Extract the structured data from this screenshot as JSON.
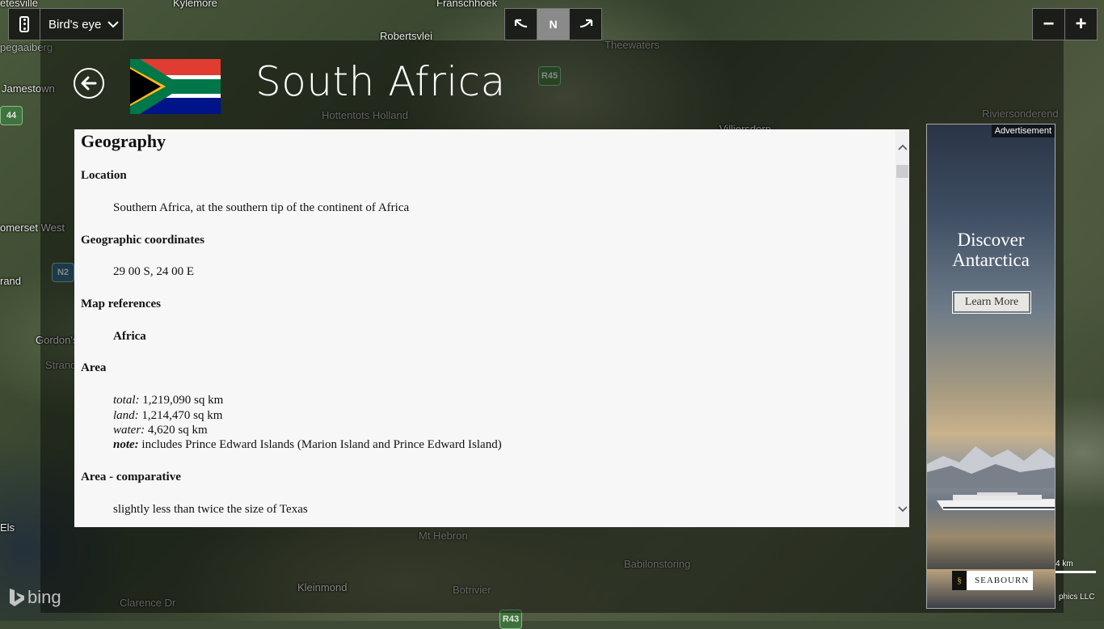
{
  "map": {
    "labels": [
      "etesville",
      "Kylemore",
      "Franschhoek",
      "Robertsvlei",
      "pegaaiberg",
      "Jamestown",
      "Theewaters",
      "Villiersdorp",
      "Hottentots Holland",
      "Riviersonderend",
      "omerset West",
      "rand",
      "Gordon's",
      "Strand",
      "Els",
      "Mt Hebron",
      "Babilonstoring",
      "Kleinmond",
      "Botrivier",
      "Clarence Dr"
    ],
    "shields": [
      "R45",
      "N2",
      "44",
      "R43"
    ]
  },
  "toolbar": {
    "view_mode": "Bird's eye",
    "compass_north": "N",
    "zoom_out": "−",
    "zoom_in": "+"
  },
  "header": {
    "title": "South Africa",
    "flag": "south-africa-flag"
  },
  "content": {
    "section_title": "Geography",
    "fields": [
      {
        "title": "Location",
        "value": "Southern Africa, at the southern tip of the continent of Africa"
      },
      {
        "title": "Geographic coordinates",
        "value": "29 00 S, 24 00 E"
      },
      {
        "title": "Map references",
        "value": "Africa"
      },
      {
        "title": "Area",
        "rows": [
          {
            "key": "total:",
            "value": " 1,219,090 sq km"
          },
          {
            "key": "land:",
            "value": " 1,214,470 sq km"
          },
          {
            "key": "water:",
            "value": " 4,620 sq km"
          },
          {
            "key": "note:",
            "value": " includes Prince Edward Islands (Marion Island and Prince Edward Island)"
          }
        ]
      },
      {
        "title": "Area - comparative",
        "value": "slightly less than twice the size of Texas"
      }
    ]
  },
  "ad": {
    "tag": "Advertisement",
    "headline_line1": "Discover",
    "headline_line2": "Antarctica",
    "cta": "Learn More",
    "brand": "SEABOURN"
  },
  "footer": {
    "logo_text": "bing",
    "scale_label": "4 km",
    "copyright": "phics LLC"
  },
  "colors": {
    "panel_overlay": "#000000",
    "content_bg": "#f7f7f7",
    "compass_active": "#8a8a8a"
  }
}
